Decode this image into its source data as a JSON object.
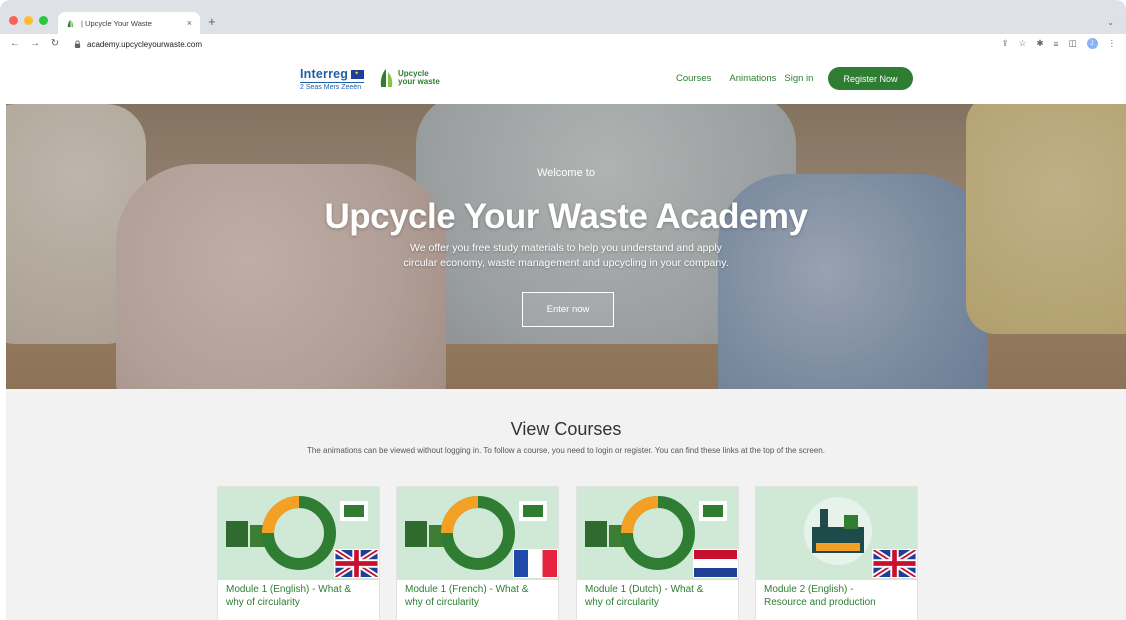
{
  "browser": {
    "tab_title": "| Upcycle Your Waste",
    "tab_close": "×",
    "new_tab": "+",
    "menu_chevron": "⌄",
    "url": "academy.upcycleyourwaste.com",
    "profile_initial": "J",
    "nav_icons": [
      "back-arrow-icon",
      "forward-arrow-icon",
      "reload-icon"
    ]
  },
  "header": {
    "interreg_logo": "Interreg",
    "interreg_sub": "2 Seas Mers Zeeën",
    "brand_logo_line1": "Upcycle",
    "brand_logo_line2": "your waste",
    "nav": {
      "courses": "Courses",
      "animations": "Animations",
      "sign_in": "Sign in"
    },
    "register_button": "Register Now"
  },
  "hero": {
    "welcome": "Welcome to",
    "title": "Upcycle Your Waste Academy",
    "description_line1": "We offer you free study materials to help you understand and apply",
    "description_line2": "circular economy, waste management and upcycling in your company.",
    "cta": "Enter now"
  },
  "courses": {
    "title": "View Courses",
    "subtitle": "The animations can be viewed without logging in. To follow a course, you need to login or register. You can find these links at the top of the screen.",
    "cards": [
      {
        "title_line1": "Module 1 (English) - What &",
        "title_line2": "why of circularity",
        "flag": "uk"
      },
      {
        "title_line1": "Module 1 (French) - What &",
        "title_line2": "why of circularity",
        "flag": "fr"
      },
      {
        "title_line1": "Module 1 (Dutch) - What &",
        "title_line2": "why of circularity",
        "flag": "nl"
      },
      {
        "title_line1": "Module 2 (English) -",
        "title_line2": "Resource and production",
        "flag": "uk"
      }
    ]
  },
  "colors": {
    "brand_green": "#2e7d32",
    "interreg_blue": "#1f5fa8",
    "section_bg": "#f2f2f2"
  }
}
